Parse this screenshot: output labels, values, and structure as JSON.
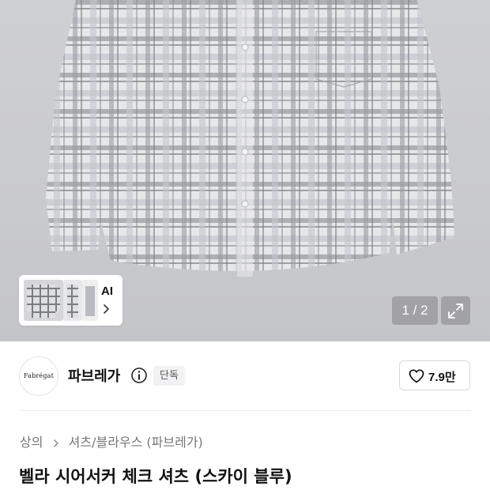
{
  "gallery": {
    "ai_label": "AI",
    "pager": "1 / 2",
    "icons": {
      "chevron": "chevron-right-icon",
      "expand": "expand-icon"
    }
  },
  "brand": {
    "logo_text": "Fabrégat",
    "name": "파브레가",
    "badge": "단독",
    "like_count": "7.9만",
    "icons": {
      "info": "info-icon",
      "heart": "heart-icon"
    }
  },
  "breadcrumb": {
    "items": [
      "상의",
      "셔츠/블라우스 (파브레가)"
    ]
  },
  "product": {
    "title": "벨라 시어서커 체크 셔츠 (스카이 블루)"
  }
}
